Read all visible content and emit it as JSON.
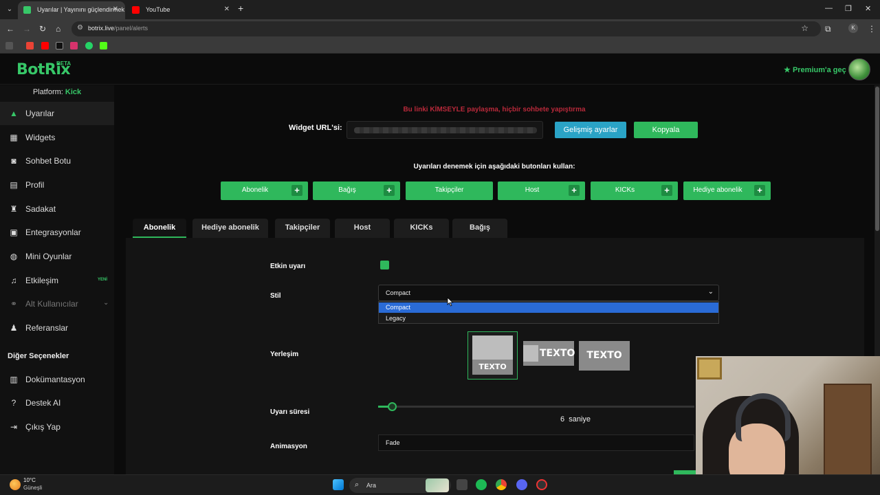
{
  "browser": {
    "tabs": [
      {
        "title": "Uyarılar | Yayınını güçlendirmek",
        "active": true
      },
      {
        "title": "YouTube",
        "active": false
      }
    ],
    "url_host": "botrix.live",
    "url_path": "/panel/alerts",
    "profile_initial": "K"
  },
  "header": {
    "logo": "BotRix",
    "logo_badge": "BETA",
    "premium": "Premium'a geç"
  },
  "sidebar": {
    "platform_label": "Platform:",
    "platform_value": "Kick",
    "items": [
      {
        "label": "Uyarılar",
        "icon": "warning-icon"
      },
      {
        "label": "Widgets",
        "icon": "grid-icon"
      },
      {
        "label": "Sohbet Botu",
        "icon": "robot-icon"
      },
      {
        "label": "Profil",
        "icon": "id-card-icon"
      },
      {
        "label": "Sadakat",
        "icon": "trophy-icon"
      },
      {
        "label": "Entegrasyonlar",
        "icon": "plug-icon"
      },
      {
        "label": "Mini Oyunlar",
        "icon": "gamepad-icon"
      },
      {
        "label": "Etkileşim",
        "icon": "music-icon",
        "badge": "YENİ"
      },
      {
        "label": "Alt Kullanıcılar",
        "icon": "users-icon"
      },
      {
        "label": "Referanslar",
        "icon": "user-group-icon"
      }
    ],
    "section_title": "Diğer Seçenekler",
    "other_items": [
      {
        "label": "Dokümantasyon",
        "icon": "book-icon"
      },
      {
        "label": "Destek AI",
        "icon": "help-icon"
      },
      {
        "label": "Çıkış Yap",
        "icon": "logout-icon"
      }
    ]
  },
  "main": {
    "warning": "Bu linki KİMSEYLE paylaşma, hiçbir sohbete yapıştırma",
    "widget_url_label": "Widget URL'si:",
    "advanced_button": "Gelişmiş ayarlar",
    "copy_button": "Kopyala",
    "try_label": "Uyarıları denemek için aşağıdaki butonları kullan:",
    "test_buttons": [
      {
        "label": "Abonelik",
        "plus": true
      },
      {
        "label": "Bağış",
        "plus": true
      },
      {
        "label": "Takipçiler",
        "plus": false
      },
      {
        "label": "Host",
        "plus": true
      },
      {
        "label": "KICKs",
        "plus": true
      },
      {
        "label": "Hediye abonelik",
        "plus": true
      }
    ],
    "tabs": [
      "Abonelik",
      "Hediye abonelik",
      "Takipçiler",
      "Host",
      "KICKs",
      "Bağış"
    ],
    "active_tab": "Abonelik",
    "form": {
      "enabled_label": "Etkin uyarı",
      "style_label": "Stil",
      "style_value": "Compact",
      "style_options": [
        "Compact",
        "Legacy"
      ],
      "layout_label": "Yerleşim",
      "layout_text": "TEXTO",
      "duration_label": "Uyarı süresi",
      "duration_value": "6",
      "duration_unit": "saniye",
      "duration_fraction": 0.04,
      "animation_label": "Animasyon",
      "animation_value": "Fade"
    }
  },
  "taskbar": {
    "temperature": "10°C",
    "weather": "Güneşli",
    "search": "Ara"
  },
  "colors": {
    "accent": "#2fb85c",
    "warning": "#b8293a",
    "info": "#2aa3c6",
    "select_highlight": "#2a6bd6"
  }
}
